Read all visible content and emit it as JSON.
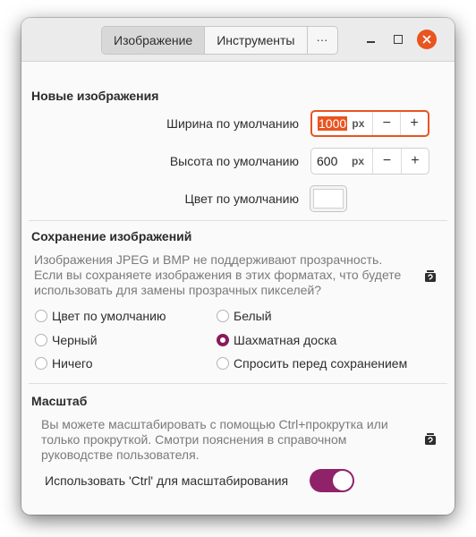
{
  "titlebar": {
    "tabs": [
      {
        "label": "Изображение",
        "active": true
      },
      {
        "label": "Инструменты",
        "active": false
      }
    ],
    "more_label": "···"
  },
  "new_images": {
    "title": "Новые изображения",
    "width_label": "Ширина по умолчанию",
    "width_value": "1000",
    "height_label": "Высота по умолчанию",
    "height_value": "600",
    "unit": "px",
    "minus": "−",
    "plus": "+",
    "color_label": "Цвет по умолчанию",
    "color_value": "#ffffff"
  },
  "saving": {
    "title": "Сохранение изображений",
    "description": [
      "Изображения JPEG и BMP не поддерживают прозрачность.",
      "Если вы сохраняете изображения в этих форматах, что будете",
      "использовать для замены прозрачных пикселей?"
    ],
    "options": [
      {
        "label": "Цвет по умолчанию",
        "checked": false
      },
      {
        "label": "Белый",
        "checked": false
      },
      {
        "label": "Черный",
        "checked": false
      },
      {
        "label": "Шахматная доска",
        "checked": true
      },
      {
        "label": "Ничего",
        "checked": false
      },
      {
        "label": "Спросить перед сохранением",
        "checked": false
      }
    ]
  },
  "zoom": {
    "title": "Масштаб",
    "description": [
      "Вы можете масштабировать с помощью Ctrl+прокрутка или",
      "только прокруткой. Смотри пояснения в справочном",
      "руководстве пользователя."
    ],
    "ctrl_label": "Использовать 'Ctrl' для масштабирования",
    "ctrl_enabled": true
  },
  "colors": {
    "accent": "#e95420",
    "toggle_on": "#8f2269",
    "radio_on": "#8a1a5a"
  }
}
